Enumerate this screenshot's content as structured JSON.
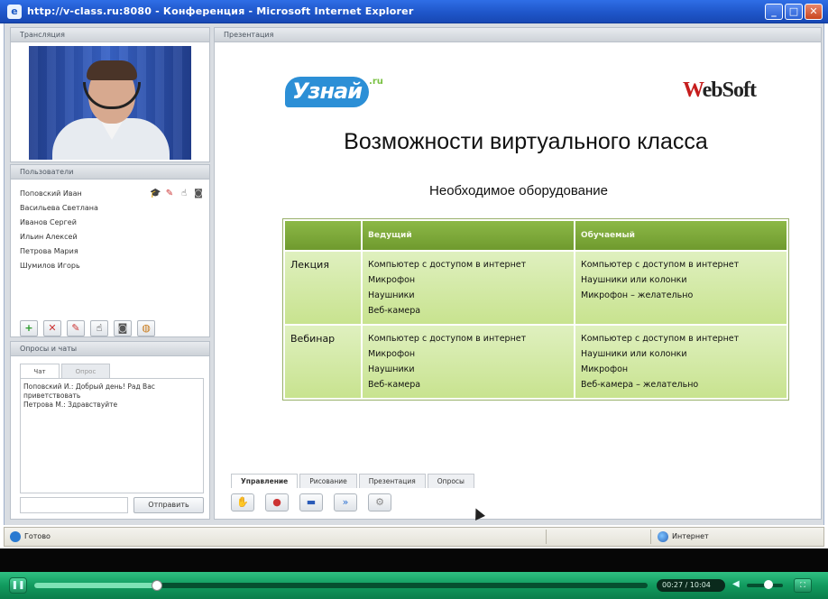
{
  "window": {
    "title": "http://v-class.ru:8080 - Конференция - Microsoft Internet Explorer",
    "buttons": {
      "minimize": "_",
      "maximize": "□",
      "close": "✕"
    }
  },
  "video_panel": {
    "header": "Трансляция"
  },
  "users_panel": {
    "header": "Пользователи",
    "users": [
      "Поповский Иван",
      "Васильева Светлана",
      "Иванов Сергей",
      "Ильин Алексей",
      "Петрова Мария",
      "Шумилов Игорь"
    ],
    "toolbar_icons": [
      "add-icon",
      "remove-icon",
      "pen-icon",
      "hand-icon",
      "camera-icon",
      "lock-icon"
    ]
  },
  "chat_panel": {
    "header": "Опросы и чаты",
    "tabs": [
      "Чат",
      "Опрос"
    ],
    "messages": [
      "Поповский И.: Добрый день! Рад Вас приветствовать",
      "Петрова М.: Здравствуйте"
    ],
    "send_label": "Отправить"
  },
  "presentation": {
    "header": "Презентация",
    "logo_left": {
      "text": "Узнай",
      "suffix": ".ru"
    },
    "logo_right": {
      "first": "W",
      "rest": "ebSoft"
    },
    "title": "Возможности виртуального класса",
    "subtitle": "Необходимое оборудование",
    "table": {
      "headers": [
        "",
        "Ведущий",
        "Обучаемый"
      ],
      "rows": [
        {
          "label": "Лекция",
          "host": [
            "Компьютер с доступом в интернет",
            "Микрофон",
            "Наушники",
            "Веб-камера"
          ],
          "student": [
            "Компьютер с доступом в интернет",
            "Наушники или колонки",
            "Микрофон – желательно"
          ]
        },
        {
          "label": "Вебинар",
          "host": [
            "Компьютер с доступом в интернет",
            "Микрофон",
            "Наушники",
            "Веб-камера"
          ],
          "student": [
            "Компьютер с доступом в интернет",
            "Наушники или колонки",
            "Микрофон",
            "Веб-камера – желательно"
          ]
        }
      ]
    },
    "control_tabs": [
      "Управление",
      "Рисование",
      "Презентация",
      "Опросы"
    ]
  },
  "statusbar": {
    "ready": "Готово",
    "zone": "Интернет"
  },
  "player": {
    "time": "00:27 / 10:04",
    "progress": 0.2,
    "volume": 0.6
  }
}
